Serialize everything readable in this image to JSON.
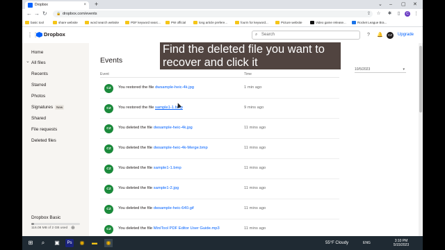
{
  "browser": {
    "tab_title": "Dropbox",
    "tab_close": "×",
    "new_tab": "+",
    "window_controls": [
      "⌄",
      "–",
      "▢",
      "✕"
    ],
    "url": "dropbox.com/events",
    "nav": {
      "back": "←",
      "forward": "→",
      "reload": "↻",
      "home": "⌂"
    },
    "profile_initial": "C"
  },
  "bookmarks": [
    "basic tool",
    "share website",
    "word search website",
    "PDF keyword searc...",
    "PW official",
    "long article prefere...",
    "fourm for keyword...",
    "Picture website",
    "Video game release...",
    "Rocket League Bra..."
  ],
  "header": {
    "logo": "Dropbox",
    "search_placeholder": "Search",
    "avatar_initials": "CZ",
    "upgrade": "Upgrade"
  },
  "sidebar": {
    "items": [
      {
        "label": "Home"
      },
      {
        "label": "All files"
      },
      {
        "label": "Recents"
      },
      {
        "label": "Starred"
      },
      {
        "label": "Photos"
      },
      {
        "label": "Signatures",
        "badge": "New"
      },
      {
        "label": "Shared"
      },
      {
        "label": "File requests"
      },
      {
        "label": "Deleted files"
      }
    ],
    "plan": "Dropbox Basic",
    "usage": "116.08 MB of 2 GB used",
    "usage_fraction": 0.058
  },
  "main": {
    "title": "Events",
    "col_event": "Event",
    "col_time": "Time",
    "date_filter": "10/5/2023",
    "rows": [
      {
        "initials": "CZ",
        "prefix": "You restored the file ",
        "file": "dwsample-heic-4k.jpg",
        "time": "1 min ago"
      },
      {
        "initials": "CZ",
        "prefix": "You restored the file ",
        "file": "sample1-1.bmp",
        "time": "9 mins ago"
      },
      {
        "initials": "CZ",
        "prefix": "You deleted the file ",
        "file": "dwsample-heic-4k.jpg",
        "time": "11 mins ago"
      },
      {
        "initials": "CZ",
        "prefix": "You deleted the file ",
        "file": "dwsample-heic-4k-Merge.bmp",
        "time": "11 mins ago"
      },
      {
        "initials": "CZ",
        "prefix": "You deleted the file ",
        "file": "sample1-1.bmp",
        "time": "11 mins ago"
      },
      {
        "initials": "CZ",
        "prefix": "You deleted the file ",
        "file": "sample1-2.jpg",
        "time": "11 mins ago"
      },
      {
        "initials": "CZ",
        "prefix": "You deleted the file ",
        "file": "dwsample-heic-640.gif",
        "time": "11 mins ago"
      },
      {
        "initials": "CZ",
        "prefix": "You deleted the file ",
        "file": "MiniTool PDF Editor User Guide.mp3",
        "time": "11 mins ago"
      }
    ]
  },
  "callout": {
    "line1": "Find the deleted file you want to",
    "line2": "recover and click it"
  },
  "taskbar": {
    "weather": "55°F  Cloudy",
    "lang": "ENG",
    "time": "3:10 PM",
    "date": "5/15/2023"
  },
  "colors": {
    "accent": "#0061fe",
    "avatar_green": "#1b8a3b",
    "callout_bg": "#463834"
  }
}
